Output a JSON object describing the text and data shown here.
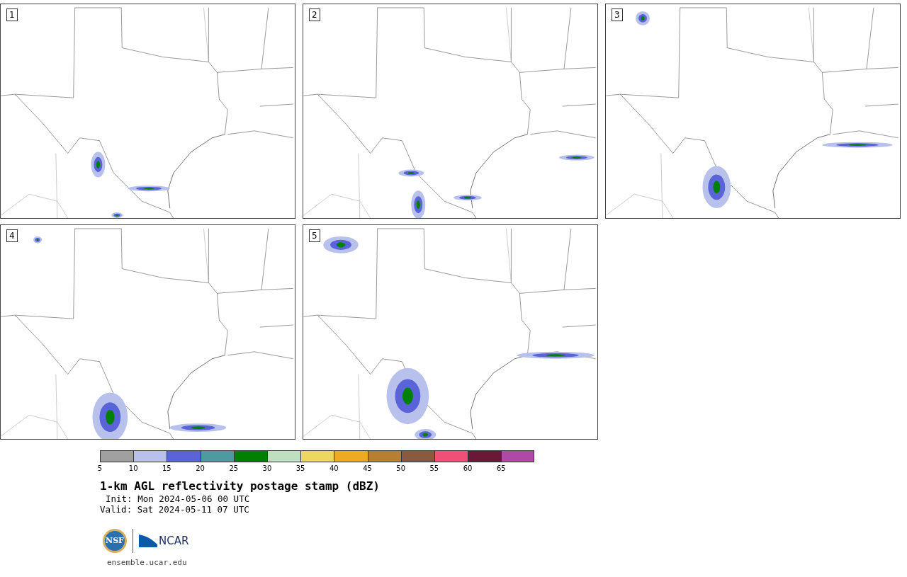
{
  "panels": [
    {
      "label": "1"
    },
    {
      "label": "2"
    },
    {
      "label": "3"
    },
    {
      "label": "4"
    },
    {
      "label": "5"
    }
  ],
  "colorbar": {
    "segments": [
      {
        "color": "#a0a0a0"
      },
      {
        "color": "#b8c0ec"
      },
      {
        "color": "#5a64d8"
      },
      {
        "color": "#4d9aa0"
      },
      {
        "color": "#008000"
      },
      {
        "color": "#bfe0c0"
      },
      {
        "color": "#ecd860"
      },
      {
        "color": "#eeaa22"
      },
      {
        "color": "#b78030"
      },
      {
        "color": "#8a5a40"
      },
      {
        "color": "#f05078"
      },
      {
        "color": "#6a1838"
      },
      {
        "color": "#b048a8"
      }
    ],
    "ticks": [
      "5",
      "10",
      "15",
      "20",
      "25",
      "30",
      "35",
      "40",
      "45",
      "50",
      "55",
      "60",
      "65"
    ]
  },
  "title": "1-km AGL reflectivity postage stamp (dBZ)",
  "init": "Init: Mon 2024-05-06 00 UTC",
  "valid": "Valid: Sat 2024-05-11 07 UTC",
  "logo": {
    "nsf": "NSF",
    "ncar": "NCAR"
  },
  "footer": "ensemble.ucar.edu"
}
